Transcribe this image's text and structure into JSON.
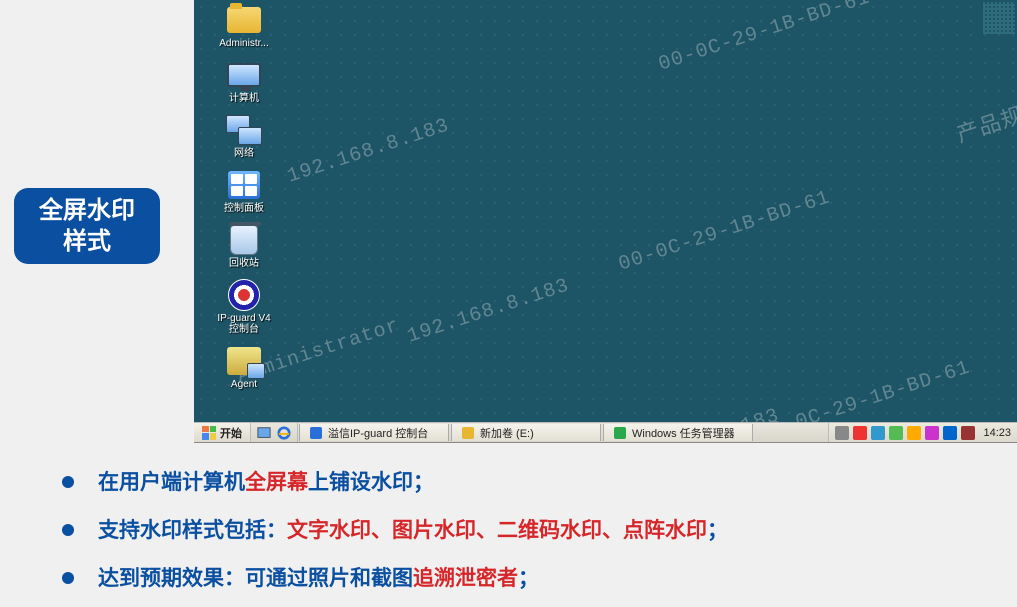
{
  "sideLabel": "全屏水印\n样式",
  "watermark": {
    "user": "Administrator",
    "ip": "192.168.8.183",
    "mac": "00-0C-29-1B-BD-61",
    "dept": "产品规划部"
  },
  "desktopIcons": [
    {
      "name": "administrator-folder-icon",
      "label": "Administr..."
    },
    {
      "name": "computer-icon",
      "label": "计算机"
    },
    {
      "name": "network-icon",
      "label": "网络"
    },
    {
      "name": "control-panel-icon",
      "label": "控制面板"
    },
    {
      "name": "recycle-bin-icon",
      "label": "回收站"
    },
    {
      "name": "ipguard-v4-console-icon",
      "label": "IP-guard V4\n控制台"
    },
    {
      "name": "agent-icon",
      "label": "Agent"
    }
  ],
  "taskbar": {
    "start": "开始",
    "items": [
      {
        "label": "溢信IP-guard 控制台"
      },
      {
        "label": "新加卷 (E:)"
      },
      {
        "label": "Windows 任务管理器"
      }
    ],
    "clock": "14:23"
  },
  "bullets": [
    {
      "parts": [
        {
          "text": "在用户端计算机",
          "color": "blue"
        },
        {
          "text": "全屏幕",
          "color": "red"
        },
        {
          "text": "上铺设水印；",
          "color": "blue"
        }
      ]
    },
    {
      "parts": [
        {
          "text": "支持水印样式包括：",
          "color": "blue"
        },
        {
          "text": "文字水印、图片水印、二维码水印、点阵水印",
          "color": "red"
        },
        {
          "text": "；",
          "color": "blue"
        }
      ]
    },
    {
      "parts": [
        {
          "text": "达到预期效果：可通过照片和截图",
          "color": "blue"
        },
        {
          "text": "追溯泄密者",
          "color": "red"
        },
        {
          "text": "；",
          "color": "blue"
        }
      ]
    }
  ]
}
